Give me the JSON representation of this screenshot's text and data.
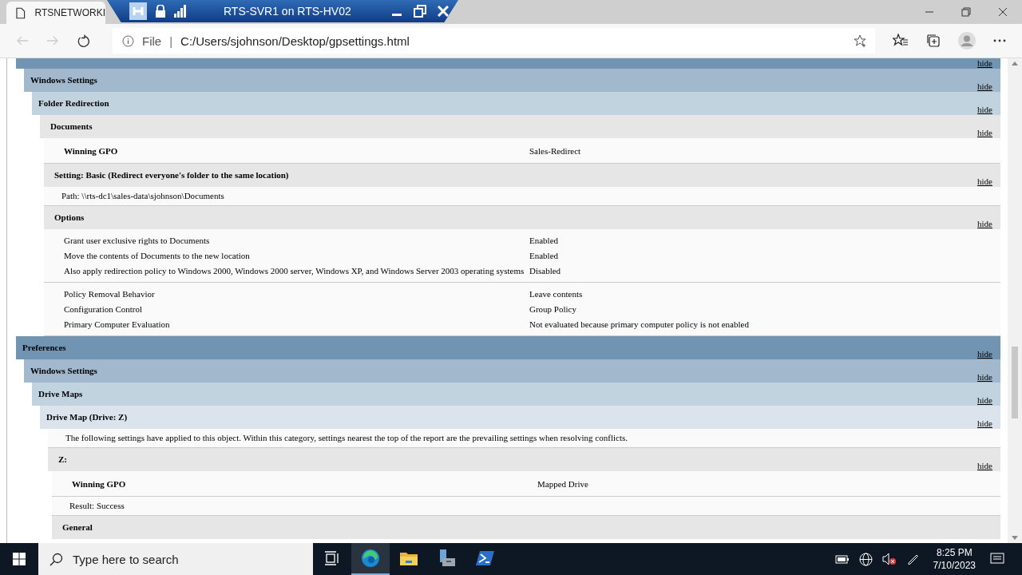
{
  "browser": {
    "tab_title": "RTSNETWORKI",
    "nav": [
      {
        "kind": "back",
        "disabled": true
      },
      {
        "kind": "forward",
        "disabled": true
      },
      {
        "kind": "refresh",
        "disabled": false
      }
    ],
    "scheme": "File",
    "separator": "|",
    "url": "C:/Users/sjohnson/Desktop/gpsettings.html"
  },
  "remote_bar": {
    "title": "RTS-SVR1 on RTS-HV02"
  },
  "report": [
    {
      "kind": "category",
      "toggle": "hide",
      "children": [
        {
          "kind": "category",
          "title": "Windows Settings",
          "toggle": "hide",
          "children": [
            {
              "kind": "category",
              "title": "Folder Redirection",
              "toggle": "hide",
              "children": [
                {
                  "kind": "object",
                  "title": "Documents",
                  "toggle": "hide",
                  "children": [
                    {
                      "kind": "pair",
                      "name": "Winning GPO",
                      "value": "Sales-Redirect"
                    },
                    {
                      "kind": "subheading",
                      "title": "Setting: Basic (Redirect everyone's folder to the same location)",
                      "toggle": "hide"
                    },
                    {
                      "kind": "text",
                      "text": "Path: \\\\rts-dc1\\sales-data\\sjohnson\\Documents"
                    },
                    {
                      "kind": "subheading",
                      "title": "Options",
                      "toggle": "hide"
                    },
                    {
                      "kind": "table",
                      "rows": [
                        {
                          "name": "Grant user exclusive rights to Documents",
                          "value": "Enabled"
                        },
                        {
                          "name": "Move the contents of Documents to the new location",
                          "value": "Enabled"
                        },
                        {
                          "name": "Also apply redirection policy to Windows 2000, Windows 2000 server, Windows XP, and Windows Server 2003 operating systems",
                          "value": "Disabled"
                        }
                      ]
                    },
                    {
                      "kind": "table",
                      "rows": [
                        {
                          "name": "Policy Removal Behavior",
                          "value": "Leave contents"
                        },
                        {
                          "name": "Configuration Control",
                          "value": "Group Policy"
                        },
                        {
                          "name": "Primary Computer Evaluation",
                          "value": "Not evaluated because primary computer policy is not enabled"
                        }
                      ]
                    }
                  ]
                }
              ]
            }
          ]
        }
      ]
    },
    {
      "kind": "category",
      "title": "Preferences",
      "toggle": "hide",
      "children": [
        {
          "kind": "category",
          "title": "Windows Settings",
          "toggle": "hide",
          "children": [
            {
              "kind": "category",
              "title": "Drive Maps",
              "toggle": "hide",
              "children": [
                {
                  "kind": "category",
                  "title": "Drive Map (Drive: Z)",
                  "toggle": "hide",
                  "children": [
                    {
                      "kind": "text",
                      "text": "The following settings have applied to this object. Within this category, settings nearest the top of the report are the prevailing settings when resolving conflicts."
                    },
                    {
                      "kind": "object",
                      "title": "Z:",
                      "toggle": "hide",
                      "children": [
                        {
                          "kind": "pair",
                          "name": "Winning GPO",
                          "value": "Mapped Drive"
                        },
                        {
                          "kind": "text",
                          "text": "Result: Success"
                        },
                        {
                          "kind": "subheading",
                          "title": "General"
                        }
                      ]
                    }
                  ]
                }
              ]
            }
          ]
        }
      ]
    }
  ],
  "taskbar": {
    "search_placeholder": "Type here to search",
    "apps": [
      {
        "kind": "taskview",
        "active": false
      },
      {
        "kind": "edge",
        "active": true
      },
      {
        "kind": "explorer",
        "active": false
      },
      {
        "kind": "server",
        "active": false
      },
      {
        "kind": "powershell",
        "active": false
      }
    ],
    "time": "8:25 PM",
    "date": "7/10/2023"
  }
}
